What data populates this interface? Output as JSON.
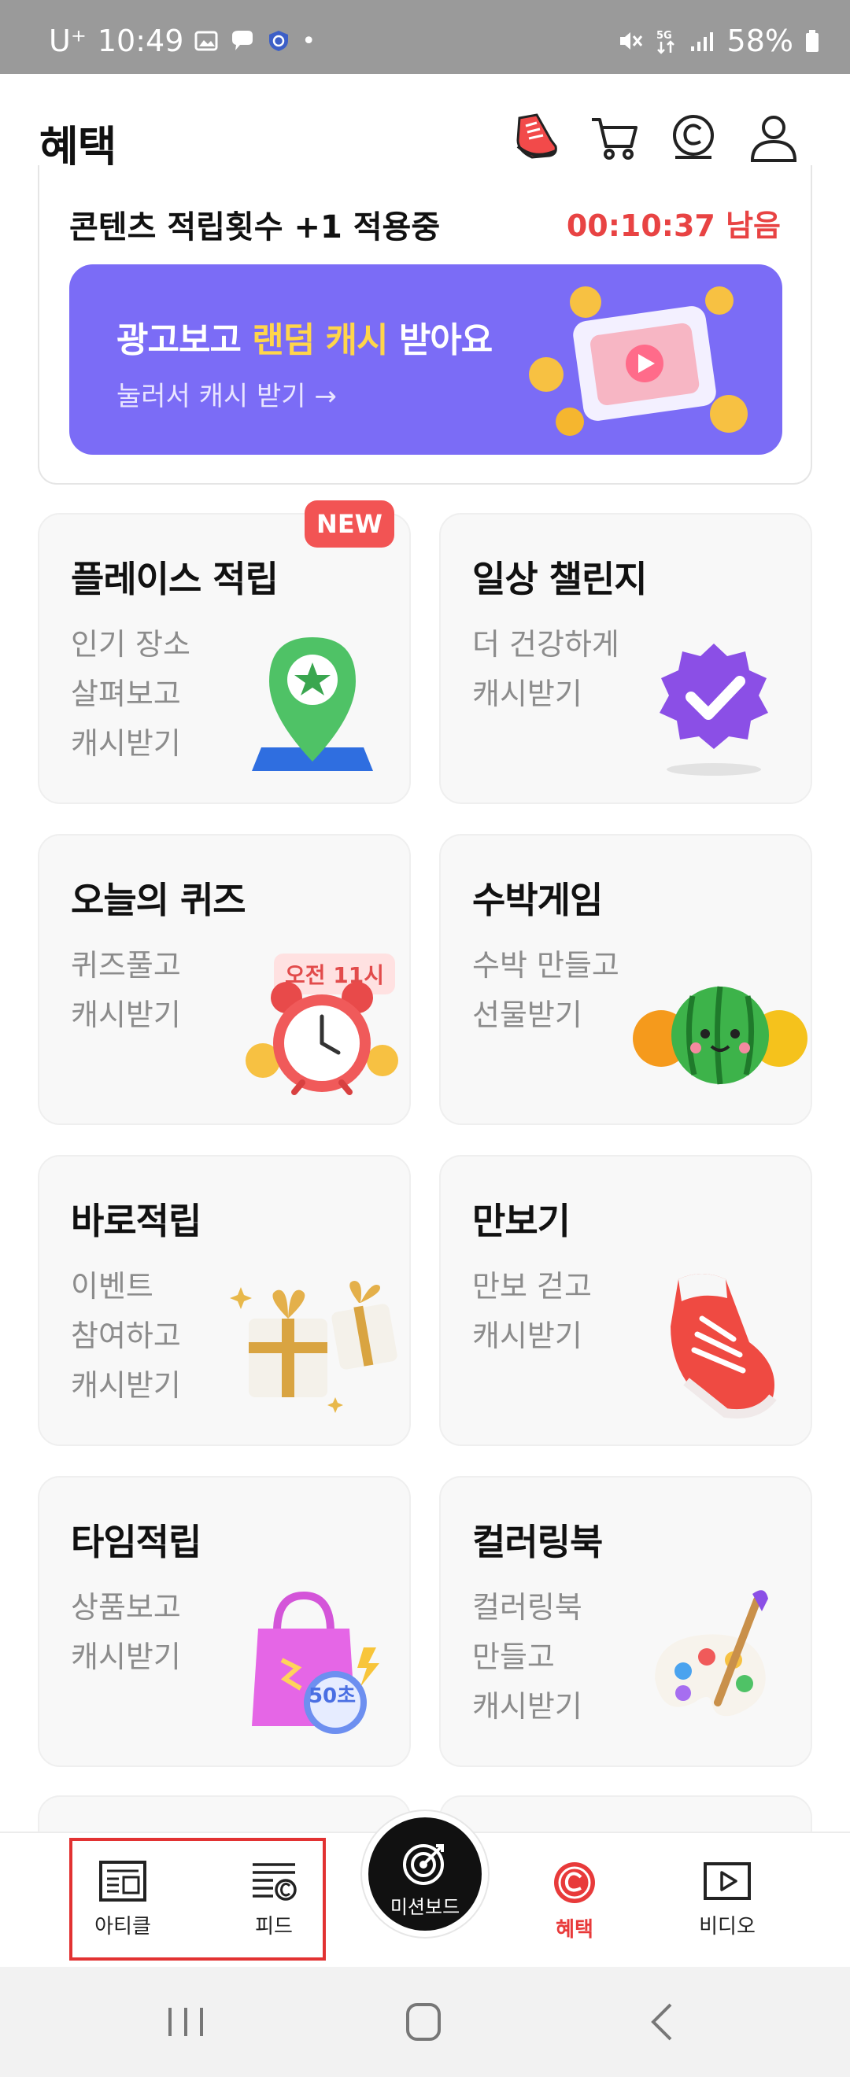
{
  "status_bar": {
    "carrier": "U⁺",
    "time": "10:49",
    "battery": "58%"
  },
  "header": {
    "title": "혜택",
    "icons": [
      "sneaker-icon",
      "cart-icon",
      "cash-coin-icon",
      "profile-icon"
    ]
  },
  "promo": {
    "title": "콘텐츠 적립횟수 +1 적용중",
    "timer": "00:10:37 남음",
    "ad": {
      "title_part1": "광고보고 ",
      "title_highlight": "랜덤 캐시",
      "title_part2": " 받아요",
      "subtitle": "눌러서 캐시 받기 →"
    }
  },
  "tiles": [
    {
      "title": "플레이스 적립",
      "desc": [
        "인기 장소",
        "살펴보고",
        "캐시받기"
      ],
      "badge": "NEW",
      "icon": "map-pin-star-icon"
    },
    {
      "title": "일상 챌린지",
      "desc": [
        "더 건강하게",
        "캐시받기"
      ],
      "icon": "check-badge-icon"
    },
    {
      "title": "오늘의 퀴즈",
      "desc": [
        "퀴즈풀고",
        "캐시받기"
      ],
      "art_label": "오전 11시",
      "icon": "alarm-clock-icon"
    },
    {
      "title": "수박게임",
      "desc": [
        "수박 만들고",
        "선물받기"
      ],
      "icon": "watermelon-icon"
    },
    {
      "title": "바로적립",
      "desc": [
        "이벤트",
        "참여하고",
        "캐시받기"
      ],
      "icon": "gift-boxes-icon"
    },
    {
      "title": "만보기",
      "desc": [
        "만보 걷고",
        "캐시받기"
      ],
      "icon": "sneaker-icon"
    },
    {
      "title": "타임적립",
      "desc": [
        "상품보고",
        "캐시받기"
      ],
      "art_label": "50초",
      "icon": "shopping-bag-timer-icon"
    },
    {
      "title": "컬러링북",
      "desc": [
        "컬러링북",
        "만들고",
        "캐시받기"
      ],
      "icon": "paint-palette-icon"
    }
  ],
  "tab_bar": {
    "tabs": [
      {
        "label": "아티클",
        "icon": "article-icon"
      },
      {
        "label": "피드",
        "icon": "feed-icon"
      },
      {
        "label": "미션보드",
        "icon": "target-icon"
      },
      {
        "label": "혜택",
        "icon": "cash-coin-icon",
        "active": true
      },
      {
        "label": "비디오",
        "icon": "video-icon"
      }
    ]
  },
  "colors": {
    "accent_red": "#e83a3a",
    "ad_purple": "#7b6cf6",
    "highlight_yellow": "#ffd54a"
  }
}
